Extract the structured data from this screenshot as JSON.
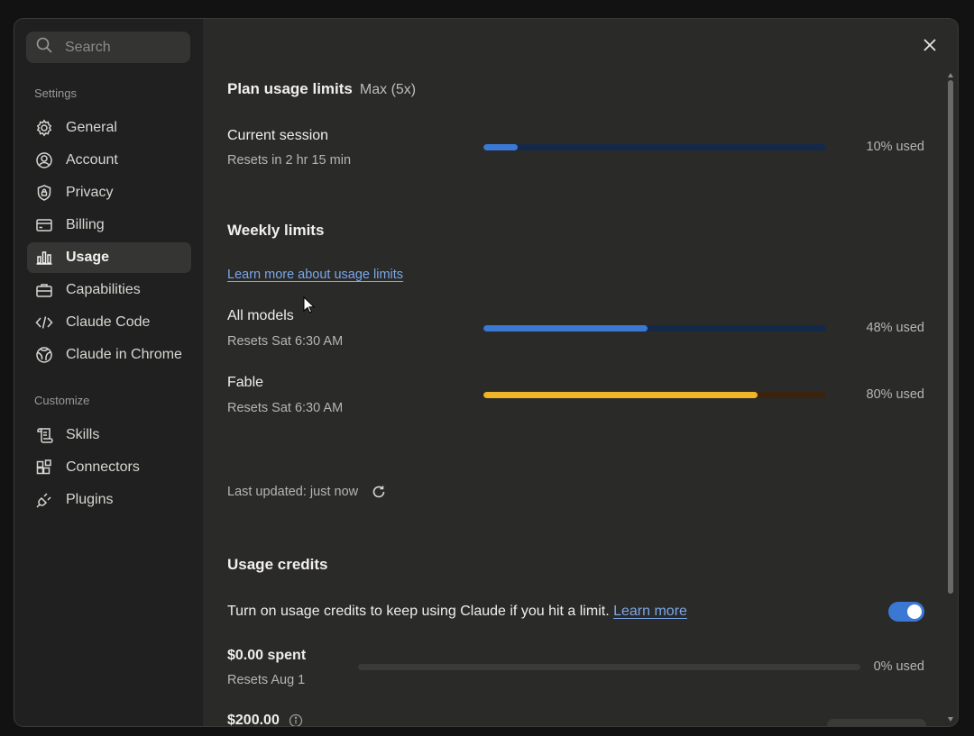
{
  "search": {
    "placeholder": "Search"
  },
  "sidebar": {
    "settings_label": "Settings",
    "settings_items": [
      {
        "label": "General",
        "icon": "gear-icon"
      },
      {
        "label": "Account",
        "icon": "user-circle-icon"
      },
      {
        "label": "Privacy",
        "icon": "shield-lock-icon"
      },
      {
        "label": "Billing",
        "icon": "credit-card-icon"
      },
      {
        "label": "Usage",
        "icon": "bar-chart-icon",
        "active": true
      },
      {
        "label": "Capabilities",
        "icon": "briefcase-icon"
      },
      {
        "label": "Claude Code",
        "icon": "code-icon"
      },
      {
        "label": "Claude in Chrome",
        "icon": "globe-icon"
      }
    ],
    "customize_label": "Customize",
    "customize_items": [
      {
        "label": "Skills",
        "icon": "scroll-icon"
      },
      {
        "label": "Connectors",
        "icon": "blocks-icon"
      },
      {
        "label": "Plugins",
        "icon": "plug-icon"
      }
    ]
  },
  "main": {
    "plan_title": "Plan usage limits",
    "plan_name": "Max (5x)",
    "current_session": {
      "title": "Current session",
      "resets": "Resets in 2 hr 15 min",
      "percent": 10,
      "used_label": "10% used"
    },
    "weekly_title": "Weekly limits",
    "learn_more_link": "Learn more about usage limits",
    "all_models": {
      "title": "All models",
      "resets": "Resets Sat 6:30 AM",
      "percent": 48,
      "used_label": "48% used"
    },
    "fable": {
      "title": "Fable",
      "resets": "Resets Sat 6:30 AM",
      "percent": 80,
      "used_label": "80% used"
    },
    "last_updated": "Last updated: just now",
    "credits_title": "Usage credits",
    "credits_text": "Turn on usage credits to keep using Claude if you hit a limit.",
    "credits_learn_more": "Learn more",
    "credits_toggle_on": true,
    "spent": {
      "title": "$0.00 spent",
      "resets": "Resets Aug 1",
      "percent": 0,
      "used_label": "0% used"
    },
    "limit_amount": "$200.00"
  },
  "colors": {
    "accent": "#3a78d4",
    "warning": "#f0b429",
    "panel": "#2a2a29",
    "sidebar": "#202020"
  }
}
